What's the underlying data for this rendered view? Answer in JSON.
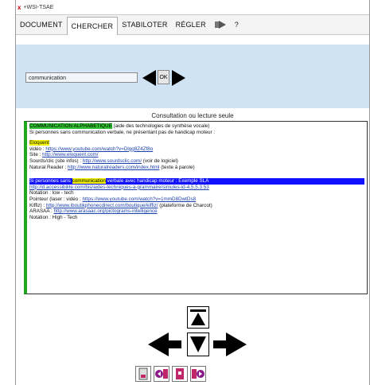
{
  "window": {
    "title": "+WSI-TSAE"
  },
  "tabs": [
    {
      "label": "DOCUMENT"
    },
    {
      "label": "CHERCHER"
    },
    {
      "label": "STABILOTER"
    },
    {
      "label": "RÉGLER"
    },
    {
      "label": "?"
    }
  ],
  "search": {
    "value": "communication"
  },
  "ok_label": "OK",
  "section_title": "Consultation ou lecture seule",
  "results": {
    "heading": "COMMUNICATION ALPHABÉTIQUE",
    "heading_rest": "(aide des technologies de synthèse vocale)",
    "line2": "Si personnes sans communication verbale, ne présentant pas de handicap moteur :",
    "b1_title": "Eloquent",
    "b1_video_label": "vidéo :",
    "b1_video_url": "https://www.youtube.com/watch?v=Dlgg8Z4Zf8o",
    "b1_site_label": "Site :",
    "b1_site_url": "http://www.eloquent.com/",
    "b1_sourds_label": "Sourds/clic (site infos) :",
    "b1_sourds_url": "http://www.sourdsclic.com/",
    "b1_sourds_rest": "(voir de logiciel)",
    "b1_natural_label": "Natural Reader :",
    "b1_natural_url": "http://www.naturalreaders.com/index.html",
    "b1_natural_rest": "(texte à parole)",
    "b2_prefix": "Si personnes sans",
    "b2_highlight": "communication",
    "b2_suffix": "verbale avec handicap moteur : Exemple SLA",
    "b2_url": "http://d.accessibilite.com/bis/aides-techniques-a-grammaire/simules-id-4.5.5.3.53",
    "b2_notation_low": "Notation : low - tech",
    "b2_pointeur": "Pointeur (laser : vidéo :",
    "b2_pointeur_url": "https://www.youtube.com/watch?v=1mmD8DwtDs8",
    "b2_kiffiz": "Kiffiz) :",
    "b2_kiffiz_url": "http://www.iboutikphonecdirect.com/boutique/kiffiz/",
    "b2_kiffiz_rest": "(plateforme de Charcot)",
    "b2_arasaac_label": "ARASAA :",
    "b2_arasaac_url": "http://www.arasaac.org/pictograms-intelligence",
    "b2_notation_high": "Notation : High - Tech"
  }
}
